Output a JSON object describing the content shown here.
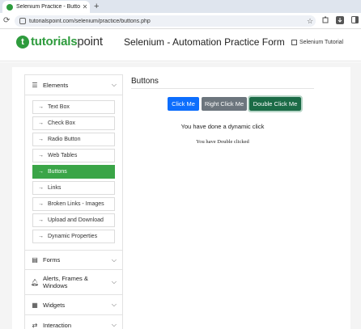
{
  "browser": {
    "tab_title": "Selenium Practice - Buttons",
    "tab_close": "✕",
    "new_tab": "+",
    "reload": "⟳",
    "url": "tutorialspoint.com/selenium/practice/buttons.php",
    "star": "☆"
  },
  "header": {
    "logo_mark": "t",
    "logo_bold": "tutorials",
    "logo_rest": "point",
    "title": "Selenium - Automation Practice Form",
    "tutorial_link": "Selenium Tutorial"
  },
  "sidebar": {
    "elements_label": "Elements",
    "items": [
      {
        "label": "Text Box"
      },
      {
        "label": "Check Box"
      },
      {
        "label": "Radio Button"
      },
      {
        "label": "Web Tables"
      },
      {
        "label": "Buttons"
      },
      {
        "label": "Links"
      },
      {
        "label": "Broken Links - Images"
      },
      {
        "label": "Upload and Download"
      },
      {
        "label": "Dynamic Properties"
      }
    ],
    "sections": [
      {
        "label": "Forms"
      },
      {
        "label": "Alerts, Frames & Windows"
      },
      {
        "label": "Widgets"
      },
      {
        "label": "Interaction"
      }
    ]
  },
  "main": {
    "title": "Buttons",
    "click_me": "Click Me",
    "right_click_me": "Right Click Me",
    "double_click_me": "Double Click Me",
    "dynamic_message": "You have done a dynamic click",
    "double_message": "You have Double clicked"
  },
  "colors": {
    "brand_green": "#2e9b3d",
    "active_item": "#3aa547",
    "primary": "#0d6efd",
    "secondary": "#6c757d",
    "success": "#1b6b46"
  }
}
